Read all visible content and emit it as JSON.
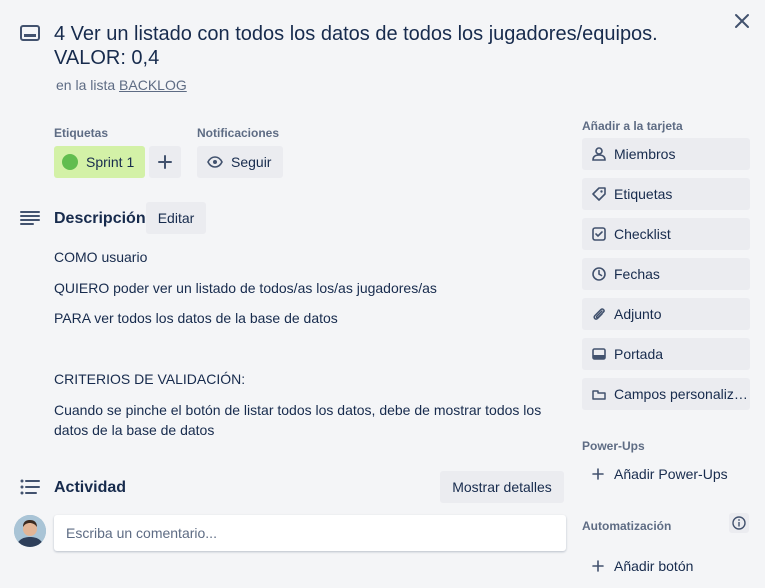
{
  "card": {
    "title": "4 Ver un listado con todos los datos de todos los jugadores/equipos. VALOR: 0,4",
    "in_list_prefix": "en la lista",
    "list_name": "BACKLOG"
  },
  "labels": {
    "heading": "Etiquetas",
    "items": [
      {
        "name": "Sprint 1",
        "color": "#61bd4f",
        "bg": "#d3f1a7"
      }
    ]
  },
  "notifications": {
    "heading": "Notificaciones",
    "follow_label": "Seguir"
  },
  "description": {
    "heading": "Descripción",
    "edit_label": "Editar",
    "lines": [
      "COMO usuario",
      "QUIERO poder ver un listado de todos/as los/as jugadores/as",
      "PARA ver todos los datos de la base de datos",
      "CRITERIOS DE VALIDACIÓN:",
      "Cuando se pinche el botón de listar todos los datos, debe de mostrar todos los datos de la base de datos"
    ]
  },
  "activity": {
    "heading": "Actividad",
    "details_label": "Mostrar detalles",
    "comment_placeholder": "Escriba un comentario..."
  },
  "sidebar": {
    "add_heading": "Añadir a la tarjeta",
    "add_items": [
      {
        "label": "Miembros",
        "icon": "person-icon"
      },
      {
        "label": "Etiquetas",
        "icon": "tag-icon"
      },
      {
        "label": "Checklist",
        "icon": "checklist-icon"
      },
      {
        "label": "Fechas",
        "icon": "clock-icon"
      },
      {
        "label": "Adjunto",
        "icon": "paperclip-icon"
      },
      {
        "label": "Portada",
        "icon": "cover-icon"
      },
      {
        "label": "Campos personalizados",
        "icon": "custom-fields-icon"
      }
    ],
    "powerups_heading": "Power-Ups",
    "add_powerups_label": "Añadir Power-Ups",
    "automation_heading": "Automatización",
    "add_button_label": "Añadir botón"
  }
}
